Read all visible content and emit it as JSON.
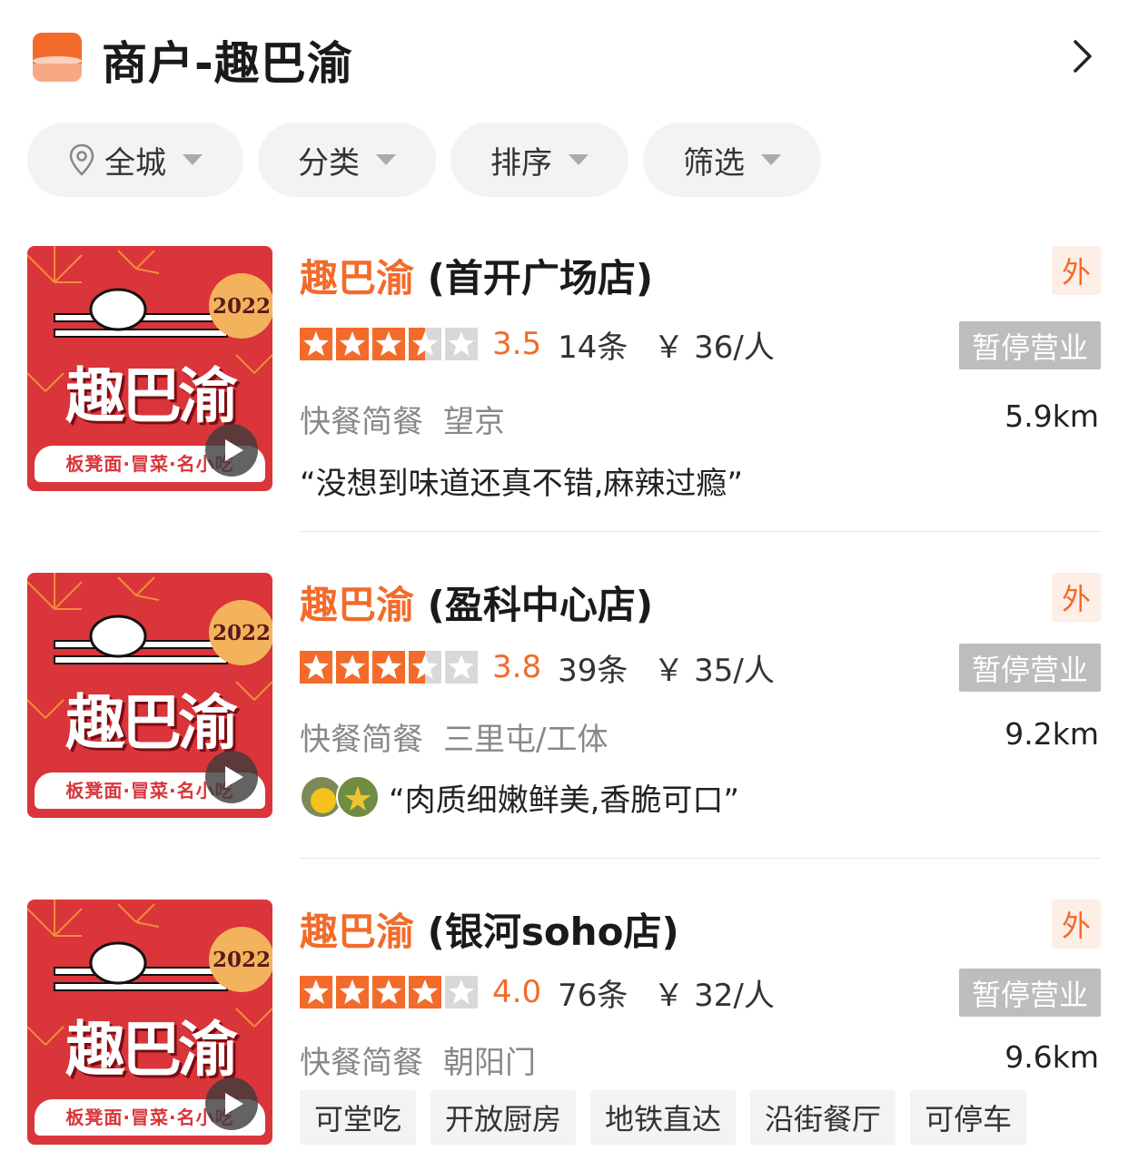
{
  "header": {
    "title": "商户-趣巴渝"
  },
  "filters": [
    {
      "label": "全城",
      "icon": "location-pin-icon"
    },
    {
      "label": "分类"
    },
    {
      "label": "排序"
    },
    {
      "label": "筛选"
    }
  ],
  "thumbnail": {
    "year": "2022",
    "brand": "趣巴渝",
    "footer": "板凳面·冒菜·名小吃"
  },
  "shops": [
    {
      "brand": "趣巴渝",
      "branch": " (首开广场店)",
      "takeout": "外",
      "score": 3.5,
      "score_text": "3.5",
      "reviews": "14条",
      "price": "￥ 36/人",
      "status": "暂停营业",
      "category": "快餐简餐",
      "area": "望京",
      "distance": "5.9km",
      "quote": "“没想到味道还真不错,麻辣过瘾”"
    },
    {
      "brand": "趣巴渝",
      "branch": " (盈科中心店)",
      "takeout": "外",
      "score": 3.8,
      "score_text": "3.8",
      "reviews": "39条",
      "price": "￥ 35/人",
      "status": "暂停营业",
      "category": "快餐简餐",
      "area": "三里屯/工体",
      "distance": "9.2km",
      "quote": "“肉质细嫩鲜美,香脆可口”"
    },
    {
      "brand": "趣巴渝",
      "branch": " (银河soho店)",
      "takeout": "外",
      "score": 4.0,
      "score_text": "4.0",
      "reviews": "76条",
      "price": "￥ 32/人",
      "status": "暂停营业",
      "category": "快餐简餐",
      "area": "朝阳门",
      "distance": "9.6km",
      "tags": [
        "可堂吃",
        "开放厨房",
        "地铁直达",
        "沿街餐厅",
        "可停车"
      ]
    }
  ],
  "colors": {
    "accent": "#f26b2b",
    "closed": "#bdbdbd",
    "thumb_red": "#d9353a"
  }
}
